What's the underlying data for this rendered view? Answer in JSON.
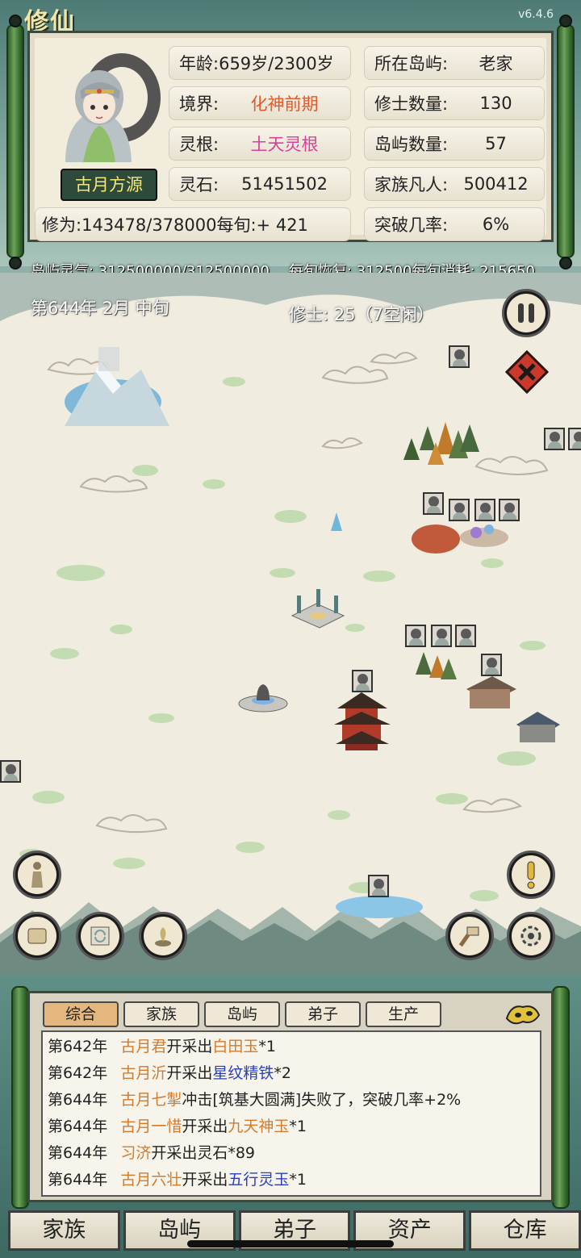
{
  "header": {
    "logo": "修仙",
    "version": "v6.4.6"
  },
  "character": {
    "name": "古月方源",
    "stats": [
      {
        "label": "年龄:",
        "value": "659岁/2300岁",
        "value_color": "#222222"
      },
      {
        "label": "所在岛屿:",
        "value": "老家",
        "value_color": "#222222"
      },
      {
        "label": "境界:",
        "value": "化神前期",
        "value_color": "#e05a2a"
      },
      {
        "label": "修士数量:",
        "value": "130",
        "value_color": "#222222"
      },
      {
        "label": "灵根:",
        "value": "土天灵根",
        "value_color": "#d8409a"
      },
      {
        "label": "岛屿数量:",
        "value": "57",
        "value_color": "#222222"
      },
      {
        "label": "灵石:",
        "value": "51451502",
        "value_color": "#222222"
      },
      {
        "label": "家族凡人:",
        "value": "500412",
        "value_color": "#222222"
      },
      {
        "label": "修为:",
        "value": "143478/378000每旬:+ 421",
        "value_color": "#222222"
      },
      {
        "label": "突破几率:",
        "value": "6%",
        "value_color": "#222222"
      }
    ]
  },
  "island_status": {
    "qi": "岛屿灵气: 312500000/312500000",
    "regen": "每旬恢复: 312500每旬消耗: 215650"
  },
  "map": {
    "date": "第644年 2月 中旬",
    "cultivators": "修士: 25（7空闲）",
    "buttons": [
      "pause-icon",
      "close-icon",
      "statue-icon",
      "alert-icon",
      "scroll-icon",
      "exchange-icon",
      "herb-icon",
      "hammer-icon",
      "gear-icon"
    ]
  },
  "log": {
    "tabs": [
      "综合",
      "家族",
      "岛屿",
      "弟子",
      "生产"
    ],
    "active_tab": "综合",
    "entries": [
      {
        "year": "第642年",
        "name": "古月君",
        "action": "开采出",
        "item": "白田玉",
        "suffix": "*1",
        "item_color": "#d57a2b"
      },
      {
        "year": "第642年",
        "name": "古月沂",
        "action": "开采出",
        "item": "星纹精铁",
        "suffix": "*2",
        "item_color": "#2a3fb8"
      },
      {
        "year": "第644年",
        "name": "古月七掣",
        "action": "冲击[筑基大圆满]失败了，突破几率+2%",
        "item": "",
        "suffix": "",
        "item_color": "#222222"
      },
      {
        "year": "第644年",
        "name": "古月一惜",
        "action": "开采出",
        "item": "九天神玉",
        "suffix": "*1",
        "item_color": "#d57a2b"
      },
      {
        "year": "第644年",
        "name": "习济",
        "action": "开采出灵石*89",
        "item": "",
        "suffix": "",
        "item_color": "#222222"
      },
      {
        "year": "第644年",
        "name": "古月六壮",
        "action": "开采出",
        "item": "五行灵玉",
        "suffix": "*1",
        "item_color": "#2a3fb8"
      }
    ]
  },
  "bottom_nav": [
    "家族",
    "岛屿",
    "弟子",
    "资产",
    "仓库"
  ],
  "colors": {
    "frame_green": "#3f7b37",
    "parchment": "#f1ece0",
    "name_orange": "#d57a2b",
    "item_blue": "#2a3fb8",
    "realm_red": "#e05a2a",
    "root_pink": "#d8409a"
  }
}
